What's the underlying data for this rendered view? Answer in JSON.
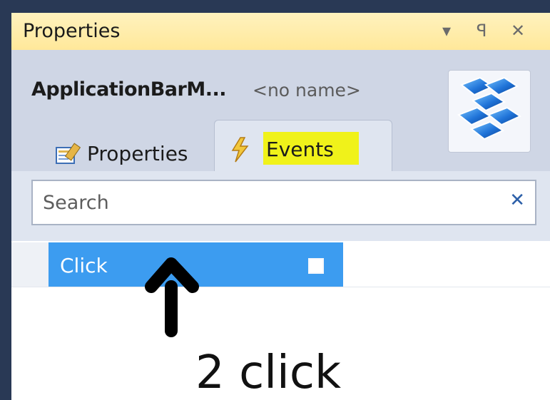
{
  "window": {
    "title": "Properties",
    "controls": {
      "dropdown": "▾",
      "pin": "ꟼ",
      "close": "✕"
    }
  },
  "header": {
    "object_name": "ApplicationBarM...",
    "object_secondary": "<no name>",
    "logo_icon": "wpf-logo-icon"
  },
  "tabs": [
    {
      "label": "Properties",
      "icon": "properties-icon",
      "active": false
    },
    {
      "label": "Events",
      "icon": "lightning-icon",
      "active": true
    }
  ],
  "search": {
    "placeholder": "Search",
    "value": "",
    "clear_icon": "clear-icon"
  },
  "grid": {
    "rows": [
      {
        "name": "Click",
        "value": "",
        "selected": true
      }
    ]
  },
  "annotation": {
    "handwriting": "2 click"
  },
  "colors": {
    "titlebar": "#ffe89a",
    "selection": "#3c9cf0",
    "highlight": "#f0f21a"
  }
}
